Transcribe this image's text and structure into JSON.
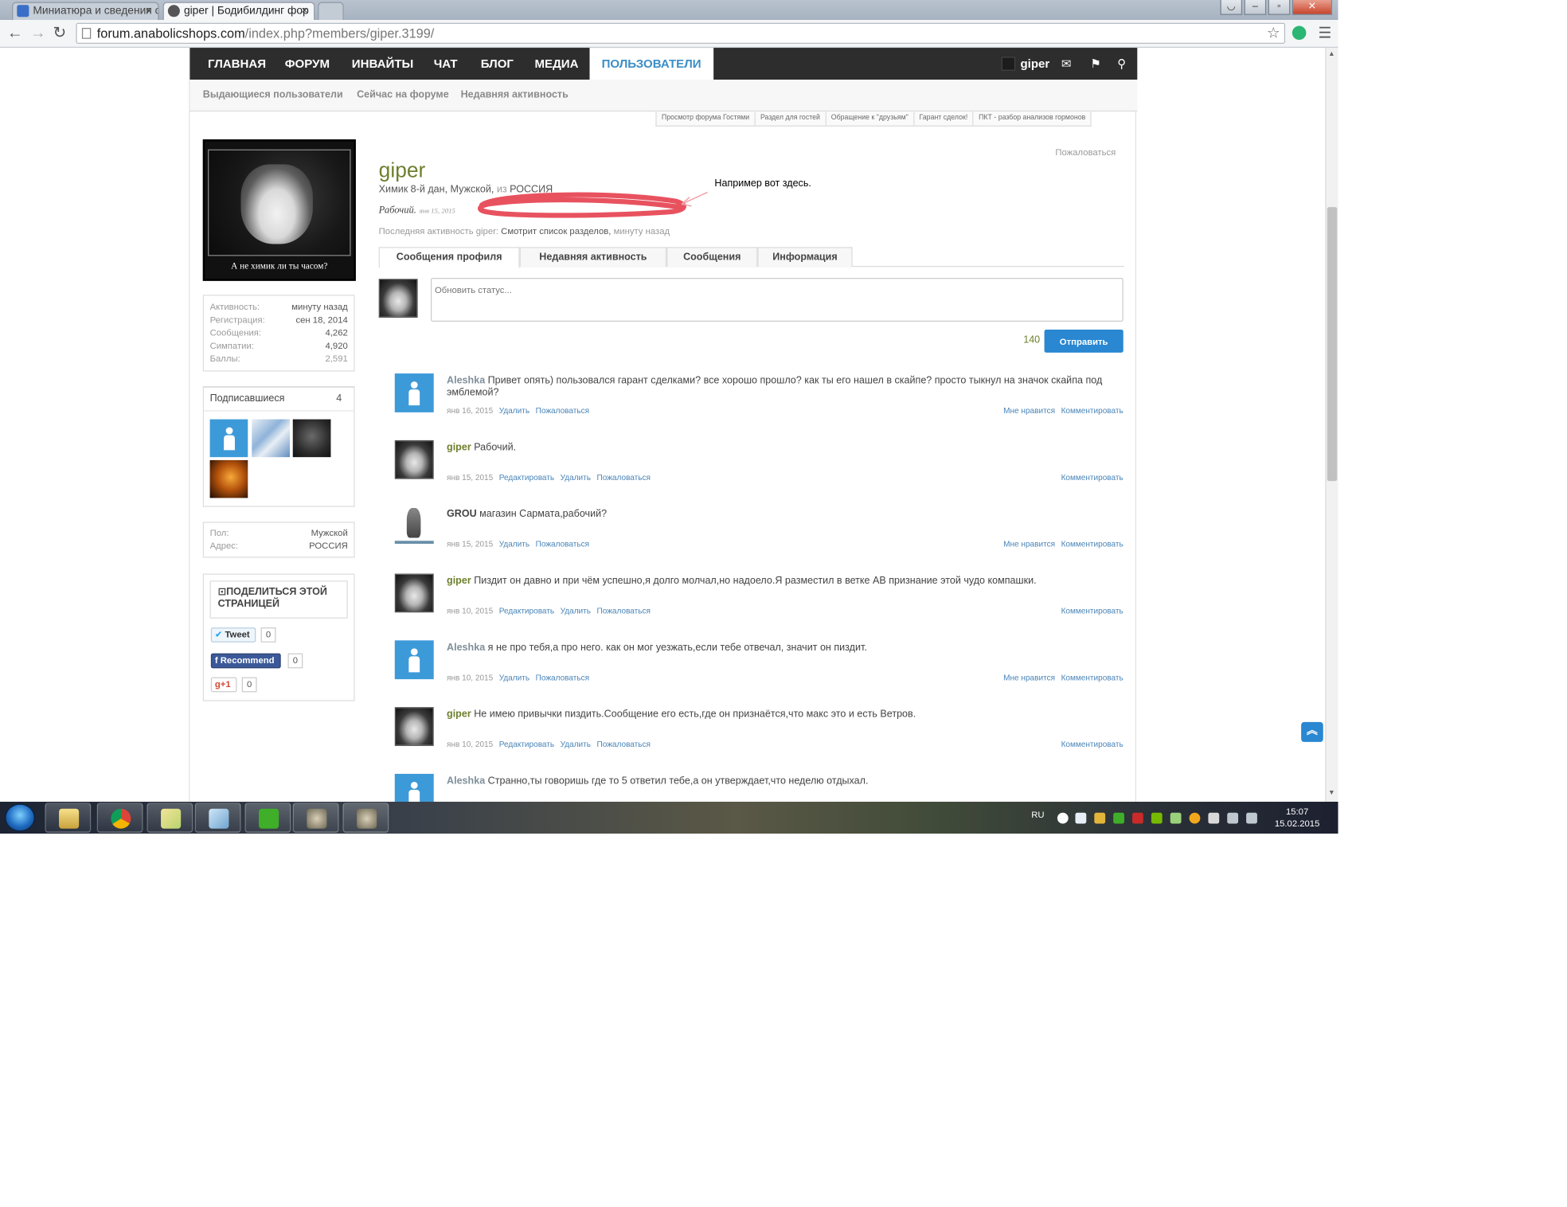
{
  "browser": {
    "tabs": [
      {
        "title": "Миниатюра и сведения о",
        "active": false
      },
      {
        "title": "giper | Бодибилдинг фор",
        "active": true
      }
    ],
    "url_domain": "forum.anabolicshops.com",
    "url_path": "/index.php?members/giper.3199/",
    "tab_close": "×"
  },
  "nav": {
    "items": [
      "ГЛАВНАЯ",
      "ФОРУМ",
      "ИНВАЙТЫ",
      "ЧАТ",
      "БЛОГ",
      "МЕДИА",
      "ПОЛЬЗОВАТЕЛИ"
    ],
    "active_index": 6,
    "user": "giper"
  },
  "subnav": [
    "Выдающиеся пользователи",
    "Сейчас на форуме",
    "Недавняя активность"
  ],
  "toplinks": [
    "Просмотр форума Гостями",
    "Раздел для гостей",
    "Обращение к \"друзьям\"",
    "Гарант сделок!",
    "ПКТ - разбор анализов гормонов"
  ],
  "sidebar": {
    "avatar_caption": "А не химик ли ты часом?",
    "stats": [
      {
        "label": "Активность:",
        "value": "минуту назад"
      },
      {
        "label": "Регистрация:",
        "value": "сен 18, 2014"
      },
      {
        "label": "Сообщения:",
        "value": "4,262"
      },
      {
        "label": "Симпатии:",
        "value": "4,920"
      },
      {
        "label": "Баллы:",
        "value": "2,591"
      }
    ],
    "followers_title": "Подписавшиеся",
    "followers_count": "4",
    "info": [
      {
        "label": "Пол:",
        "value": "Мужской"
      },
      {
        "label": "Адрес:",
        "value": "РОССИЯ"
      }
    ],
    "share_title": "ПОДЕЛИТЬСЯ ЭТОЙ СТРАНИЦЕЙ",
    "tweet_label": "Tweet",
    "tweet_count": "0",
    "recommend_label": "Recommend",
    "recommend_count": "0",
    "gplus_label": "g+1",
    "gplus_count": "0"
  },
  "profile": {
    "report": "Пожаловаться",
    "username": "giper",
    "title": "Химик 8-й дан, Мужской,",
    "from_word": "из",
    "location": "РОССИЯ",
    "status_text": "Рабочий.",
    "status_date": "янв 15, 2015",
    "annotation": "Например вот здесь.",
    "last_activity_prefix": "Последняя активность giper:",
    "last_activity_value": "Смотрит список разделов,",
    "last_activity_time": "минуту назад",
    "tabs": [
      "Сообщения профиля",
      "Недавняя активность",
      "Сообщения",
      "Информация"
    ],
    "active_tab": 0,
    "status_placeholder": "Обновить статус...",
    "char_count": "140",
    "send_label": "Отправить"
  },
  "posts": [
    {
      "author": "Aleshka",
      "avatar": "blue",
      "text": "Привет опять) пользовался гарант сделками? все хорошо прошло? как ты его нашел в скайпе? просто тыкнул на значок скайпа под эмблемой?",
      "date": "янв 16, 2015",
      "actions": [
        "Удалить",
        "Пожаловаться"
      ],
      "right": [
        "Мне нравится",
        "Комментировать"
      ]
    },
    {
      "author": "giper",
      "avatar": "husky",
      "text": "Рабочий.",
      "date": "янв 15, 2015",
      "actions": [
        "Редактировать",
        "Удалить",
        "Пожаловаться"
      ],
      "right": [
        "Комментировать"
      ]
    },
    {
      "author": "GROU",
      "avatar": "statue",
      "text": "магазин Сармата,рабочий?",
      "date": "янв 15, 2015",
      "actions": [
        "Удалить",
        "Пожаловаться"
      ],
      "right": [
        "Мне нравится",
        "Комментировать"
      ]
    },
    {
      "author": "giper",
      "avatar": "husky",
      "text": "Пиздит он давно и при чём успешно,я долго молчал,но надоело.Я разместил в ветке АВ признание этой чудо компашки.",
      "date": "янв 10, 2015",
      "actions": [
        "Редактировать",
        "Удалить",
        "Пожаловаться"
      ],
      "right": [
        "Комментировать"
      ]
    },
    {
      "author": "Aleshka",
      "avatar": "blue",
      "text": "я не про тебя,а про него. как он мог уезжать,если тебе отвечал, значит он пиздит.",
      "date": "янв 10, 2015",
      "actions": [
        "Удалить",
        "Пожаловаться"
      ],
      "right": [
        "Мне нравится",
        "Комментировать"
      ]
    },
    {
      "author": "giper",
      "avatar": "husky",
      "text": "Не имею привычки пиздить.Сообщение его есть,где он признаётся,что макс это и есть Ветров.",
      "date": "янв 10, 2015",
      "actions": [
        "Редактировать",
        "Удалить",
        "Пожаловаться"
      ],
      "right": [
        "Комментировать"
      ]
    },
    {
      "author": "Aleshka",
      "avatar": "blue",
      "text": "Странно,ты говоришь где то 5 ответил тебе,а он утверждает,что неделю отдыхал.",
      "date": "",
      "actions": [],
      "right": []
    }
  ],
  "taskbar": {
    "lang": "RU",
    "time": "15:07",
    "date": "15.02.2015"
  },
  "colors": {
    "accent_blue": "#2a87d1",
    "username_green": "#6d7f2c",
    "nav_dark": "#2d2d2d",
    "annotation_red": "#e8525f"
  }
}
